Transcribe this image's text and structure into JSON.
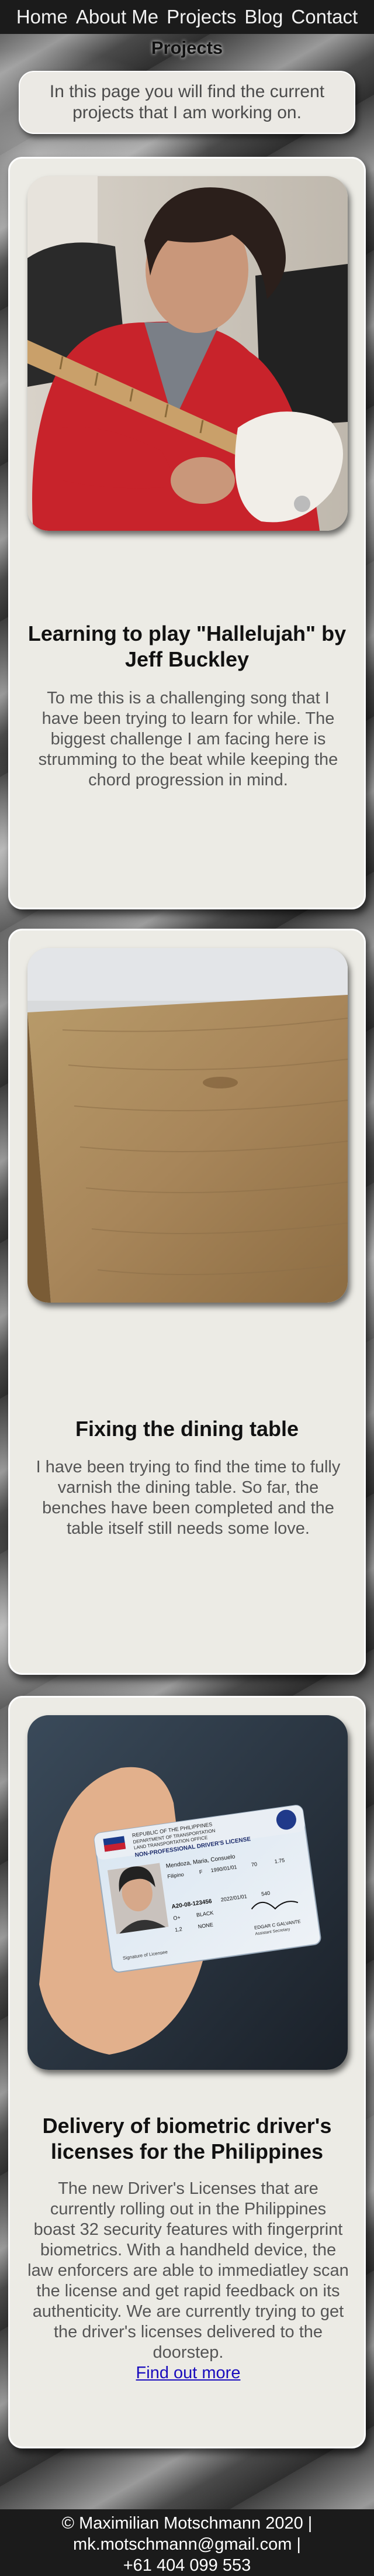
{
  "nav": {
    "items": [
      "Home",
      "About Me",
      "Projects",
      "Blog",
      "Contact"
    ]
  },
  "page": {
    "title": "Projects",
    "intro": "In this page you will find the current projects that I am working on."
  },
  "projects": [
    {
      "title": "Learning to play \"Hallelujah\" by Jeff Buckley",
      "description": "To me this is a challenging song that I have been trying to learn for while. The biggest challenge I am facing here is strumming to the beat while keeping the chord progression in mind.",
      "image": "man-playing-guitar-photo"
    },
    {
      "title": "Fixing the dining table",
      "description": "I have been trying to find the time to fully varnish the dining table. So far, the benches have been completed and the table itself still needs some love.",
      "image": "wooden-table-photo"
    },
    {
      "title": "Delivery of biometric driver's licenses for the Philippines",
      "description": "The new Driver's Licenses that are currently rolling out in the Philippines boast 32 security features with fingerprint biometrics. With a handheld device, the law enforcers are able to immediatley scan the license and get rapid feedback on its authenticity. We are currently trying to get the driver's licenses delivered to the doorstep.",
      "link": "Find out more",
      "image": "drivers-license-photo",
      "license_text": {
        "country": "REPUBLIC OF THE PHILIPPINES",
        "department": "DEPARTMENT OF TRANSPORTATION",
        "office": "LAND TRANSPORTATION OFFICE",
        "type": "NON-PROFESSIONAL DRIVER'S LICENSE",
        "name": "Mendoza, Maria, Consuelo",
        "nationality": "Filipino",
        "sex": "F",
        "dob": "1990/01/01",
        "weight": "70",
        "height": "1.75",
        "license_no": "A20-08-123456",
        "expiry": "2022/01/01",
        "agency_code": "540",
        "blood_type": "O+",
        "eyes_color": "BLACK",
        "restriction": "1,2",
        "conditions": "NONE",
        "signature_caption": "Signature of Licensee",
        "official": "EDGAR C GALVANTE",
        "official_title": "Assistant Secretary"
      }
    }
  ],
  "footer": {
    "line1": "© Maximilian Motschmann 2020 |",
    "line2": "mk.motschmann@gmail.com |",
    "line3": "+61 404 099 553"
  }
}
